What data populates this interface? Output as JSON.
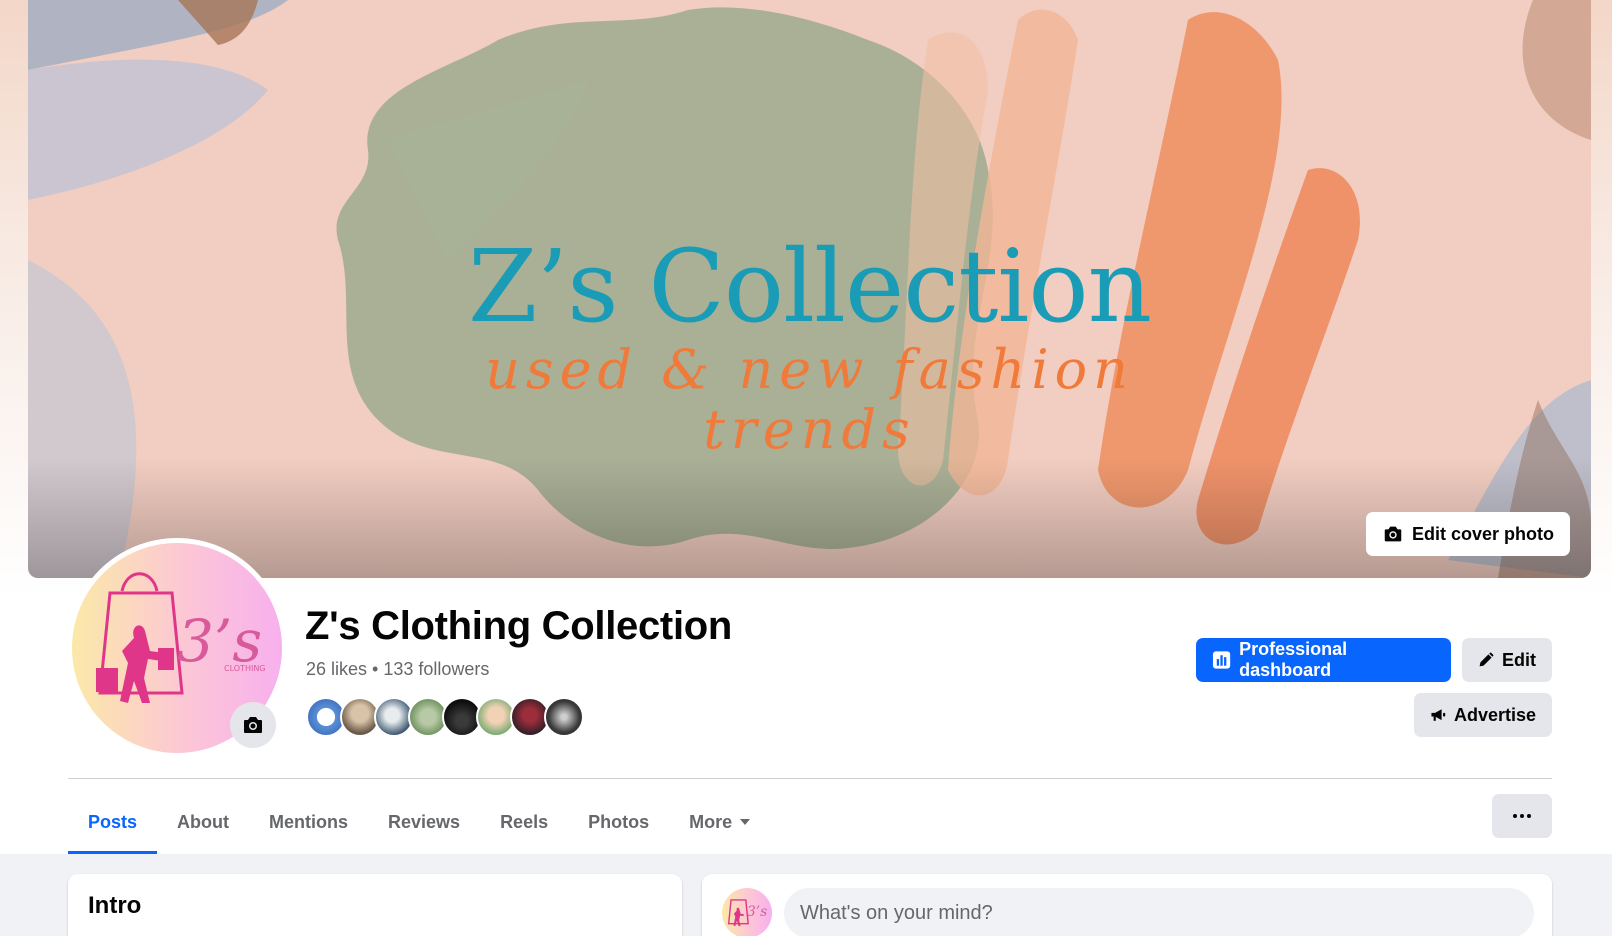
{
  "cover": {
    "title": "Z’s Collection",
    "subtitle_line1": "used & new fashion",
    "subtitle_line2": "trends",
    "edit_button_label": "Edit cover photo"
  },
  "profile": {
    "name": "Z's Clothing Collection",
    "stats": "26 likes • 133 followers",
    "avatar_text": "Z's",
    "avatar_small_text": "CLOTHING"
  },
  "actions": {
    "dashboard_label": "Professional dashboard",
    "edit_label": "Edit",
    "advertise_label": "Advertise"
  },
  "tabs": [
    {
      "label": "Posts",
      "active": true
    },
    {
      "label": "About"
    },
    {
      "label": "Mentions"
    },
    {
      "label": "Reviews"
    },
    {
      "label": "Reels"
    },
    {
      "label": "Photos"
    },
    {
      "label": "More"
    }
  ],
  "intro": {
    "title": "Intro"
  },
  "composer": {
    "placeholder": "What's on your mind?"
  },
  "colors": {
    "accent": "#0866ff",
    "secondary_button": "#e4e6eb",
    "cover_title": "#1b9cb6",
    "cover_subtitle": "#f07a3a"
  },
  "icons": {
    "camera": "camera-icon",
    "dashboard": "bar-chart-icon",
    "edit": "pencil-icon",
    "advertise": "megaphone-icon",
    "more": "three-dots-icon"
  }
}
